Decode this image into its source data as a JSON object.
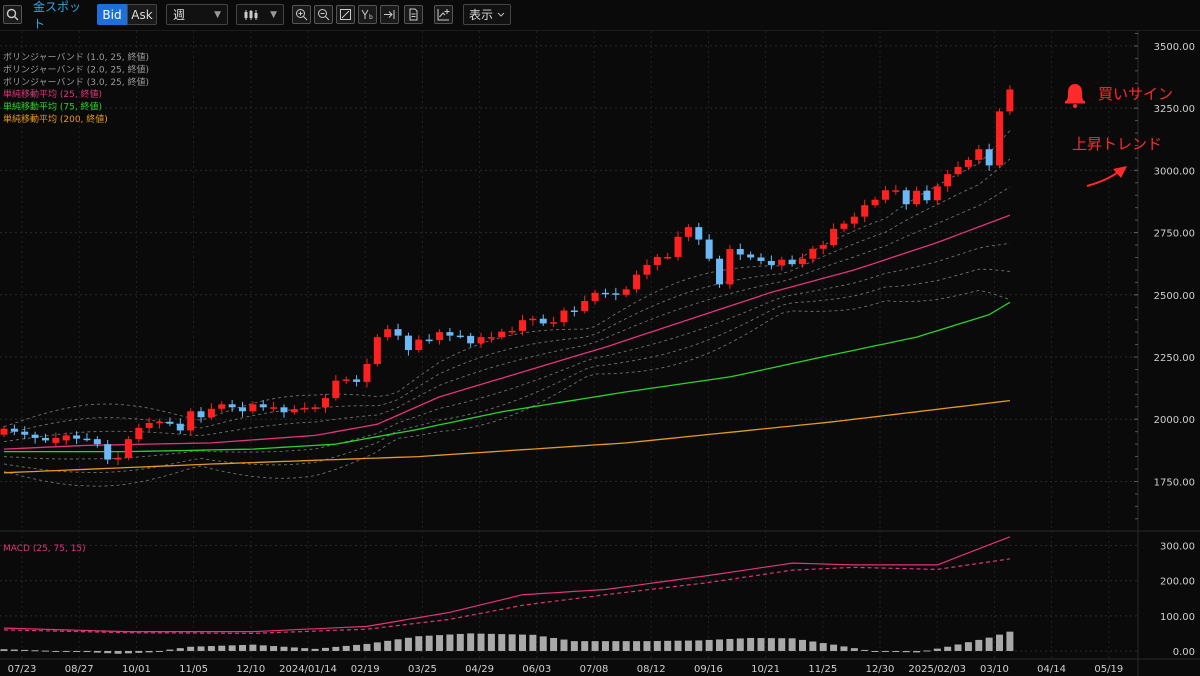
{
  "toolbar": {
    "symbol": "金スポット",
    "bid_label": "Bid",
    "ask_label": "Ask",
    "interval_value": "週",
    "display_label": "表示",
    "icons": [
      "search-icon",
      "candlestick-type-icon",
      "zoom-in-icon",
      "zoom-out-icon",
      "fit-icon",
      "indicator-icon",
      "jump-latest-icon",
      "document-icon",
      "add-study-icon",
      "chevron-down-icon"
    ]
  },
  "legend": [
    {
      "label": "ボリンジャーバンド (1.0, 25, 終値)",
      "color": "#9a9a9a"
    },
    {
      "label": "ボリンジャーバンド (2.0, 25, 終値)",
      "color": "#9a9a9a"
    },
    {
      "label": "ボリンジャーバンド (3.0, 25, 終値)",
      "color": "#9a9a9a"
    },
    {
      "label": "単純移動平均 (25, 終値)",
      "color": "#e0357a"
    },
    {
      "label": "単純移動平均 (75, 終値)",
      "color": "#2bd32b"
    },
    {
      "label": "単純移動平均 (200, 終値)",
      "color": "#e59a1e"
    }
  ],
  "annotations": {
    "buy_signal": "買いサイン",
    "uptrend": "上昇トレンド"
  },
  "chart_data": [
    {
      "type": "candlestick",
      "title": "",
      "x_tick_labels": [
        "07/23",
        "08/27",
        "10/01",
        "11/05",
        "12/10",
        "2024/01/14",
        "02/19",
        "03/25",
        "04/29",
        "06/03",
        "07/08",
        "08/12",
        "09/16",
        "10/21",
        "11/25",
        "12/30",
        "2025/02/03",
        "03/10",
        "04/14",
        "05/19"
      ],
      "y_tick_labels": [
        "3500.00",
        "3250.00",
        "3000.00",
        "2750.00",
        "2500.00",
        "2250.00",
        "2000.00",
        "1750.00"
      ],
      "ylim": [
        1555,
        3560
      ],
      "close": [
        1962,
        1950,
        1938,
        1925,
        1915,
        1925,
        1935,
        1922,
        1920,
        1900,
        1838,
        1845,
        1920,
        1965,
        1985,
        1990,
        1982,
        1955,
        2032,
        2008,
        2042,
        2060,
        2048,
        2032,
        2060,
        2048,
        2048,
        2028,
        2040,
        2046,
        2048,
        2085,
        2155,
        2160,
        2150,
        2222,
        2330,
        2362,
        2336,
        2278,
        2320,
        2318,
        2350,
        2336,
        2335,
        2305,
        2330,
        2330,
        2352,
        2355,
        2398,
        2404,
        2385,
        2390,
        2437,
        2435,
        2475,
        2508,
        2506,
        2500,
        2522,
        2581,
        2620,
        2652,
        2652,
        2733,
        2772,
        2722,
        2645,
        2542,
        2684,
        2662,
        2650,
        2636,
        2620,
        2641,
        2623,
        2645,
        2685,
        2700,
        2765,
        2786,
        2814,
        2860,
        2882,
        2920,
        2920,
        2864,
        2918,
        2880,
        2936,
        2985,
        3014,
        3042,
        3085,
        3020,
        3237,
        3325
      ],
      "open": [
        1938,
        1962,
        1950,
        1938,
        1925,
        1905,
        1915,
        1935,
        1922,
        1920,
        1900,
        1838,
        1845,
        1920,
        1965,
        1985,
        1990,
        1982,
        1955,
        2032,
        2008,
        2042,
        2060,
        2048,
        2032,
        2060,
        2048,
        2048,
        2028,
        2040,
        2046,
        2048,
        2085,
        2155,
        2160,
        2150,
        2222,
        2330,
        2362,
        2336,
        2278,
        2320,
        2318,
        2350,
        2336,
        2335,
        2305,
        2330,
        2330,
        2352,
        2355,
        2398,
        2404,
        2385,
        2390,
        2437,
        2435,
        2475,
        2508,
        2506,
        2500,
        2522,
        2581,
        2620,
        2652,
        2652,
        2733,
        2772,
        2722,
        2645,
        2542,
        2684,
        2662,
        2650,
        2636,
        2620,
        2641,
        2623,
        2645,
        2685,
        2700,
        2765,
        2786,
        2814,
        2860,
        2882,
        2920,
        2920,
        2864,
        2918,
        2880,
        2936,
        2985,
        3014,
        3042,
        3085,
        3020,
        3237
      ],
      "sma25_key_points": [
        [
          0,
          1880
        ],
        [
          8,
          1895
        ],
        [
          20,
          1905
        ],
        [
          30,
          1935
        ],
        [
          36,
          1980
        ],
        [
          42,
          2090
        ],
        [
          50,
          2190
        ],
        [
          58,
          2290
        ],
        [
          66,
          2400
        ],
        [
          74,
          2510
        ],
        [
          82,
          2600
        ],
        [
          90,
          2710
        ],
        [
          97,
          2820
        ]
      ],
      "sma75_key_points": [
        [
          0,
          1870
        ],
        [
          12,
          1870
        ],
        [
          24,
          1880
        ],
        [
          32,
          1900
        ],
        [
          40,
          1960
        ],
        [
          48,
          2030
        ],
        [
          60,
          2110
        ],
        [
          70,
          2170
        ],
        [
          80,
          2260
        ],
        [
          88,
          2330
        ],
        [
          95,
          2420
        ],
        [
          97,
          2470
        ]
      ],
      "sma200_key_points": [
        [
          0,
          1785
        ],
        [
          20,
          1820
        ],
        [
          40,
          1850
        ],
        [
          60,
          1905
        ],
        [
          80,
          1990
        ],
        [
          97,
          2075
        ]
      ],
      "bollinger_note": "bands at ±1σ, ±2σ, ±3σ around SMA(25)"
    },
    {
      "type": "macd",
      "title": "MACD (25, 75, 15)",
      "y_tick_labels": [
        "300.00",
        "200.00",
        "100.00",
        "0.00"
      ],
      "ylim": [
        -20,
        330
      ],
      "macd_key_points": [
        [
          0,
          65
        ],
        [
          12,
          55
        ],
        [
          24,
          55
        ],
        [
          35,
          70
        ],
        [
          43,
          110
        ],
        [
          50,
          160
        ],
        [
          58,
          175
        ],
        [
          68,
          215
        ],
        [
          76,
          250
        ],
        [
          82,
          245
        ],
        [
          90,
          245
        ],
        [
          97,
          325
        ]
      ],
      "signal_key_points": [
        [
          0,
          60
        ],
        [
          12,
          52
        ],
        [
          24,
          50
        ],
        [
          35,
          62
        ],
        [
          43,
          90
        ],
        [
          50,
          130
        ],
        [
          58,
          160
        ],
        [
          68,
          195
        ],
        [
          76,
          230
        ],
        [
          82,
          238
        ],
        [
          90,
          232
        ],
        [
          97,
          262
        ]
      ],
      "histogram_key_points": [
        [
          0,
          5
        ],
        [
          8,
          -3
        ],
        [
          11,
          -8
        ],
        [
          14,
          -4
        ],
        [
          18,
          12
        ],
        [
          24,
          18
        ],
        [
          30,
          6
        ],
        [
          35,
          20
        ],
        [
          40,
          42
        ],
        [
          45,
          50
        ],
        [
          51,
          46
        ],
        [
          55,
          28
        ],
        [
          62,
          28
        ],
        [
          67,
          30
        ],
        [
          72,
          37
        ],
        [
          76,
          36
        ],
        [
          80,
          18
        ],
        [
          84,
          -2
        ],
        [
          88,
          -4
        ],
        [
          91,
          12
        ],
        [
          95,
          38
        ],
        [
          97,
          55
        ]
      ]
    }
  ]
}
